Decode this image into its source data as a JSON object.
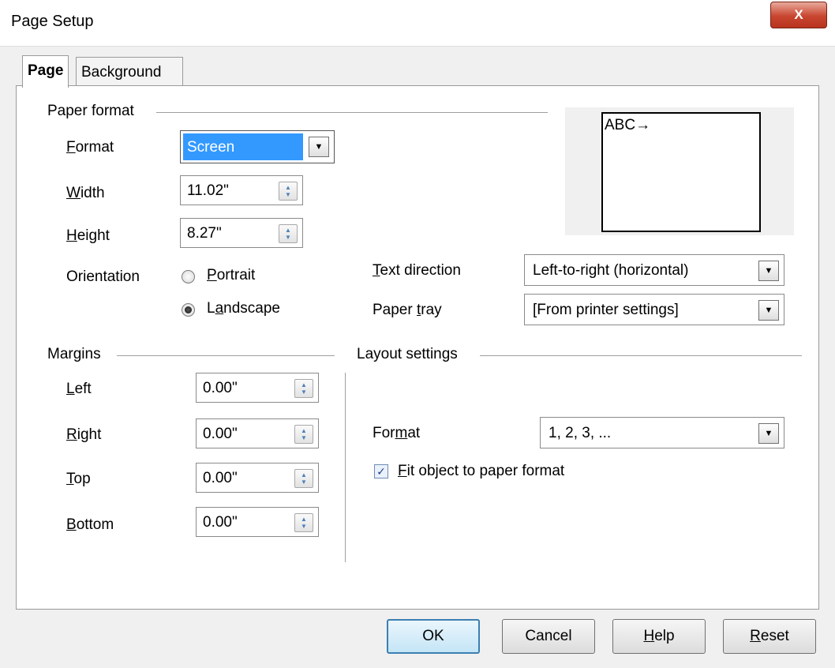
{
  "window": {
    "title": "Page Setup",
    "close_label": "X"
  },
  "tabs": [
    {
      "label": "Page",
      "active": true
    },
    {
      "label": "Background",
      "active": false
    }
  ],
  "paper_format": {
    "heading": "Paper format",
    "format_label_u": "F",
    "format_label_rest": "ormat",
    "format_value": "Screen",
    "width_label_u": "W",
    "width_label_rest": "idth",
    "width_value": "11.02\"",
    "height_label_u": "H",
    "height_label_rest": "eight",
    "height_value": "8.27\"",
    "orientation_label": "Orientation",
    "portrait_u": "P",
    "portrait_rest": "ortrait",
    "landscape_pre": "L",
    "landscape_u": "a",
    "landscape_rest": "ndscape",
    "orientation_selected": "Landscape",
    "text_direction_u": "T",
    "text_direction_rest": "ext direction",
    "text_direction_value": "Left-to-right (horizontal)",
    "paper_tray_pre": "Paper ",
    "paper_tray_u": "t",
    "paper_tray_rest": "ray",
    "paper_tray_value": "[From printer settings]"
  },
  "preview": {
    "text": "ABC→"
  },
  "margins": {
    "heading": "Margins",
    "left_u": "L",
    "left_rest": "eft",
    "left_value": "0.00\"",
    "right_u": "R",
    "right_rest": "ight",
    "right_value": "0.00\"",
    "top_u": "T",
    "top_rest": "op",
    "top_value": "0.00\"",
    "bottom_u": "B",
    "bottom_rest": "ottom",
    "bottom_value": "0.00\""
  },
  "layout": {
    "heading": "Layout settings",
    "format_pre": "For",
    "format_u": "m",
    "format_rest": "at",
    "format_value": "1, 2, 3, ...",
    "fit_u": "F",
    "fit_rest": "it object to paper format",
    "fit_checked": true
  },
  "buttons": {
    "ok": "OK",
    "cancel": "Cancel",
    "help_u": "H",
    "help_rest": "elp",
    "reset_u": "R",
    "reset_rest": "eset"
  },
  "colors": {
    "default_button_border": "#3c7fb1",
    "selection": "#3399ff",
    "close_button": "#c8452f"
  }
}
